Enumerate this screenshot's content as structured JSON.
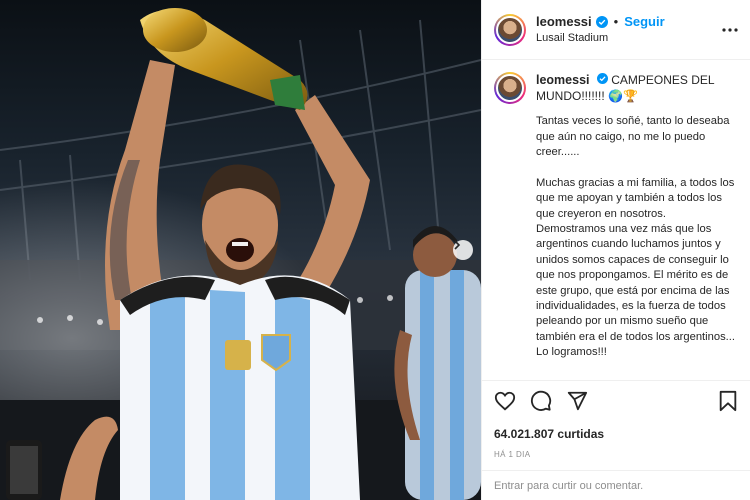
{
  "post": {
    "username": "leomessi",
    "follow_label": "Seguir",
    "separator": "•",
    "location": "Lusail Stadium",
    "caption_title": "CAMPEONES DEL MUNDO!!!!!!! 🌍🏆",
    "caption_text": "Tantas veces lo soñé, tanto lo deseaba que aún no caigo, no me lo puedo creer......\n\nMuchas gracias a mi familia, a todos los que me apoyan y también a todos los que creyeron en nosotros. Demostramos una vez más que los argentinos cuando luchamos juntos y unidos somos capaces de conseguir lo que nos propongamos. El mérito es de este grupo, que está por encima de las individualidades, es la fuerza de todos peleando por un mismo sueño que también era el de todos los argentinos... Lo logramos!!!",
    "likes": "64.021.807 curtidas",
    "time_ago": "HÁ 1 DIA",
    "comment_placeholder": "Entrar para curtir ou comentar."
  },
  "icons": {
    "verified": "verified-badge-icon",
    "more": "more-options-icon",
    "like": "heart-icon",
    "comment": "comment-icon",
    "share": "share-icon",
    "save": "bookmark-icon",
    "next": "chevron-right-icon"
  },
  "colors": {
    "accent": "#0095f6",
    "text": "#262626",
    "muted": "#8e8e8e",
    "border": "#efefef"
  }
}
